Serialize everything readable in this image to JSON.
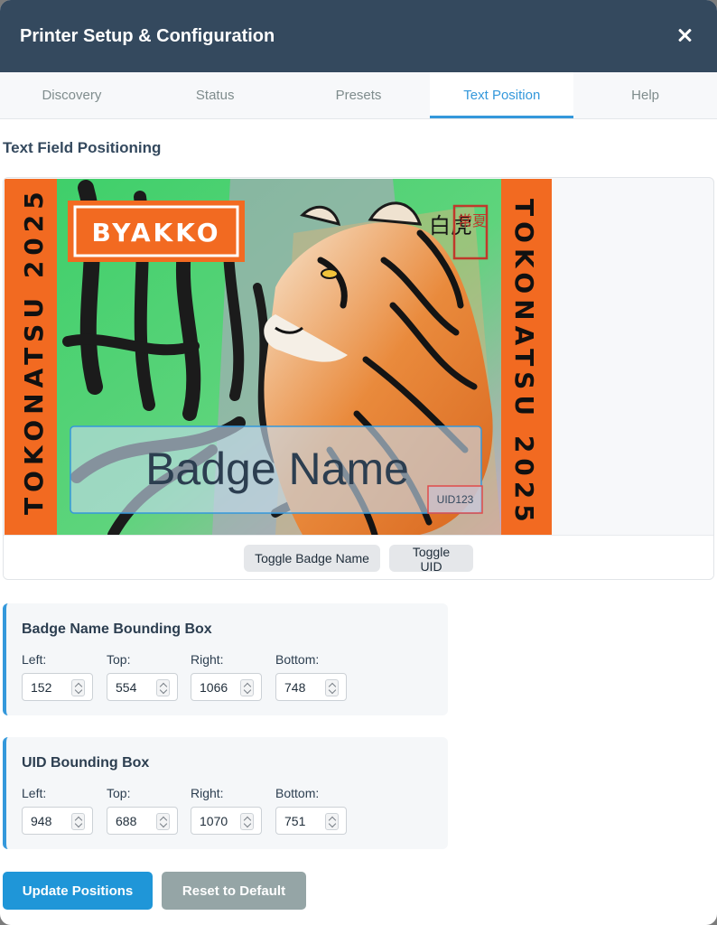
{
  "window": {
    "title": "Printer Setup & Configuration"
  },
  "tabs": [
    {
      "label": "Discovery",
      "active": false
    },
    {
      "label": "Status",
      "active": false
    },
    {
      "label": "Presets",
      "active": false
    },
    {
      "label": "Text Position",
      "active": true
    },
    {
      "label": "Help",
      "active": false
    }
  ],
  "section_title": "Text Field Positioning",
  "badge": {
    "side_text": "TOKONATSU 2025",
    "logo_text": "BYAKKO",
    "kanji": "白虎",
    "seal_text": "常夏",
    "name_placeholder": "Badge Name",
    "uid_placeholder": "UID123"
  },
  "toggles": {
    "badge_name": "Toggle Badge Name",
    "uid": "Toggle UID"
  },
  "badge_name_box": {
    "title": "Badge Name Bounding Box",
    "fields": [
      {
        "label": "Left:",
        "value": "152"
      },
      {
        "label": "Top:",
        "value": "554"
      },
      {
        "label": "Right:",
        "value": "1066"
      },
      {
        "label": "Bottom:",
        "value": "748"
      }
    ]
  },
  "uid_box": {
    "title": "UID Bounding Box",
    "fields": [
      {
        "label": "Left:",
        "value": "948"
      },
      {
        "label": "Top:",
        "value": "688"
      },
      {
        "label": "Right:",
        "value": "1070"
      },
      {
        "label": "Bottom:",
        "value": "751"
      }
    ]
  },
  "buttons": {
    "update": "Update Positions",
    "reset": "Reset to Default"
  },
  "colors": {
    "header": "#34495e",
    "accent": "#3498db",
    "badge_orange": "#f26a21",
    "badge_green": "#3fcf6a",
    "reset_button": "#95a5a6",
    "update_button": "#1f96d8"
  },
  "icons": {
    "close": "close-icon",
    "spinner": "spinner-icon"
  }
}
